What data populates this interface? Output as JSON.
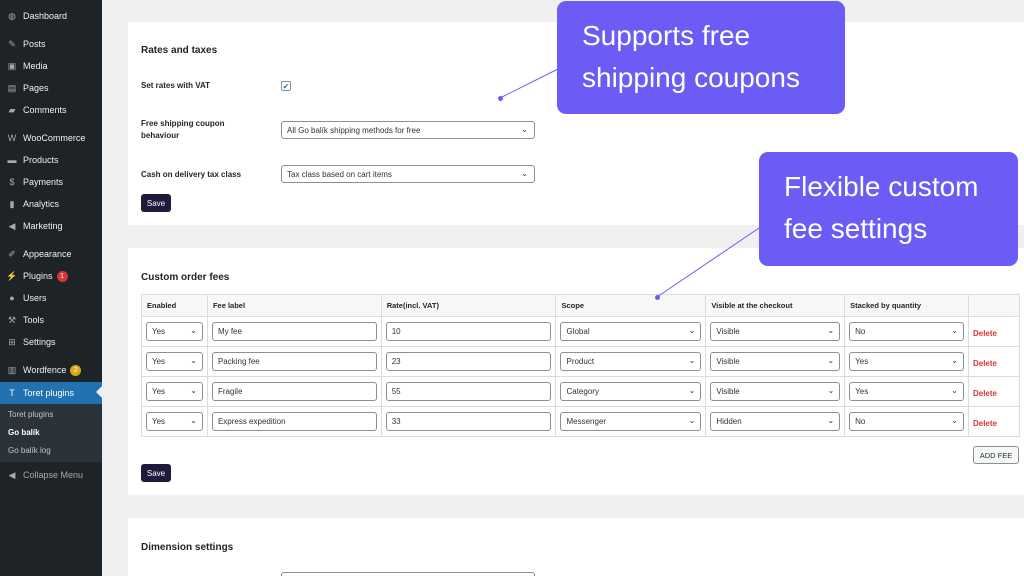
{
  "sidebar": {
    "items": [
      {
        "label": "Dashboard",
        "icon": "dashboard-icon",
        "glyph": "◍"
      },
      {
        "label": "Posts",
        "icon": "pin-icon",
        "glyph": "✎"
      },
      {
        "label": "Media",
        "icon": "media-icon",
        "glyph": "▣"
      },
      {
        "label": "Pages",
        "icon": "pages-icon",
        "glyph": "▤"
      },
      {
        "label": "Comments",
        "icon": "comments-icon",
        "glyph": "▰"
      },
      {
        "label": "WooCommerce",
        "icon": "woocommerce-icon",
        "glyph": "W"
      },
      {
        "label": "Products",
        "icon": "products-icon",
        "glyph": "▬"
      },
      {
        "label": "Payments",
        "icon": "payments-icon",
        "glyph": "$"
      },
      {
        "label": "Analytics",
        "icon": "analytics-icon",
        "glyph": "▮"
      },
      {
        "label": "Marketing",
        "icon": "marketing-icon",
        "glyph": "◀"
      },
      {
        "label": "Appearance",
        "icon": "brush-icon",
        "glyph": "✐"
      },
      {
        "label": "Plugins",
        "icon": "plugins-icon",
        "glyph": "⚡",
        "badge": "1"
      },
      {
        "label": "Users",
        "icon": "user-icon",
        "glyph": "●"
      },
      {
        "label": "Tools",
        "icon": "wrench-icon",
        "glyph": "⚒"
      },
      {
        "label": "Settings",
        "icon": "settings-icon",
        "glyph": "⊞"
      },
      {
        "label": "Wordfence",
        "icon": "wordfence-icon",
        "glyph": "▥",
        "badge": "2"
      },
      {
        "label": "Toret plugins",
        "icon": "toret-icon",
        "glyph": "T"
      }
    ],
    "submenu": [
      "Toret plugins",
      "Go balík",
      "Go balík log"
    ],
    "collapse_label": "Collapse Menu"
  },
  "rates_card": {
    "title": "Rates and taxes",
    "vat_label": "Set rates with VAT",
    "vat_checked": true,
    "coupon_label_1": "Free shipping coupon",
    "coupon_label_2": "behaviour",
    "coupon_value": "All Go balík shipping methods for free",
    "cod_label": "Cash on delivery tax class",
    "cod_value": "Tax class based on cart items",
    "save": "Save"
  },
  "fees_card": {
    "title": "Custom order fees",
    "headers": [
      "Enabled",
      "Fee label",
      "Rate(incl. VAT)",
      "Scope",
      "Visible at the checkout",
      "Stacked by quantity",
      ""
    ],
    "rows": [
      {
        "enabled": "Yes",
        "label": "My fee",
        "rate": "10",
        "scope": "Global",
        "visible": "Visible",
        "stacked": "No",
        "delete": "Delete"
      },
      {
        "enabled": "Yes",
        "label": "Packing fee",
        "rate": "23",
        "scope": "Product",
        "visible": "Visible",
        "stacked": "Yes",
        "delete": "Delete"
      },
      {
        "enabled": "Yes",
        "label": "Fragile",
        "rate": "55",
        "scope": "Category",
        "visible": "Visible",
        "stacked": "Yes",
        "delete": "Delete"
      },
      {
        "enabled": "Yes",
        "label": "Express expedition",
        "rate": "33",
        "scope": "Messenger",
        "visible": "Hidden",
        "stacked": "No",
        "delete": "Delete"
      }
    ],
    "add_fee": "ADD FEE",
    "save": "Save"
  },
  "dimension_card": {
    "title": "Dimension settings"
  },
  "callouts": {
    "coupons_1": "Supports free",
    "coupons_2": "shipping coupons",
    "fees_1": "Flexible custom",
    "fees_2": "fee settings"
  },
  "colors": {
    "accent": "#6a5cf5",
    "sidebar": "#1d2327",
    "active": "#2271b1",
    "save_button": "#1e1a3c",
    "delete": "#d63638"
  }
}
